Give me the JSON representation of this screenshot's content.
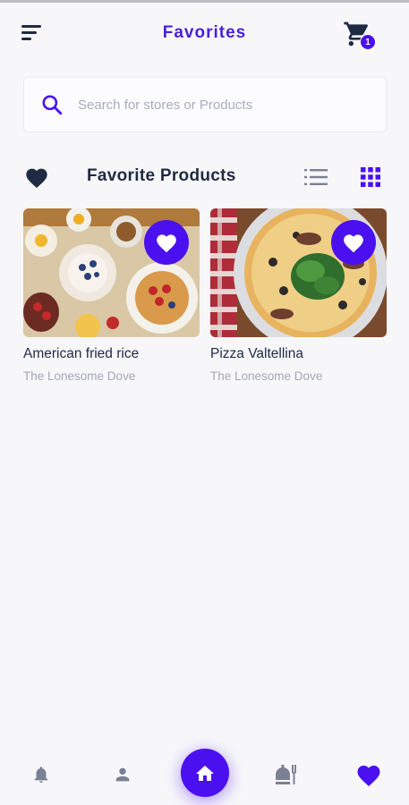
{
  "header": {
    "title": "Favorites",
    "cart_count": "1"
  },
  "search": {
    "placeholder": "Search for stores or Products",
    "value": ""
  },
  "section": {
    "title": "Favorite Products"
  },
  "products": [
    {
      "name": "American fried rice",
      "store": "The Lonesome Dove",
      "favorited": true
    },
    {
      "name": "Pizza Valtellina",
      "store": "The Lonesome Dove",
      "favorited": true
    }
  ],
  "bottom_nav": {
    "items": [
      {
        "icon": "bell-icon",
        "active": false
      },
      {
        "icon": "user-icon",
        "active": false
      },
      {
        "icon": "home-icon",
        "active": true
      },
      {
        "icon": "food-tray-icon",
        "active": false
      },
      {
        "icon": "heart-icon",
        "active": true
      }
    ]
  },
  "colors": {
    "accent": "#4a10ef",
    "text": "#1f2a44",
    "muted": "#a4a7b4",
    "background": "#f7f7fa"
  }
}
